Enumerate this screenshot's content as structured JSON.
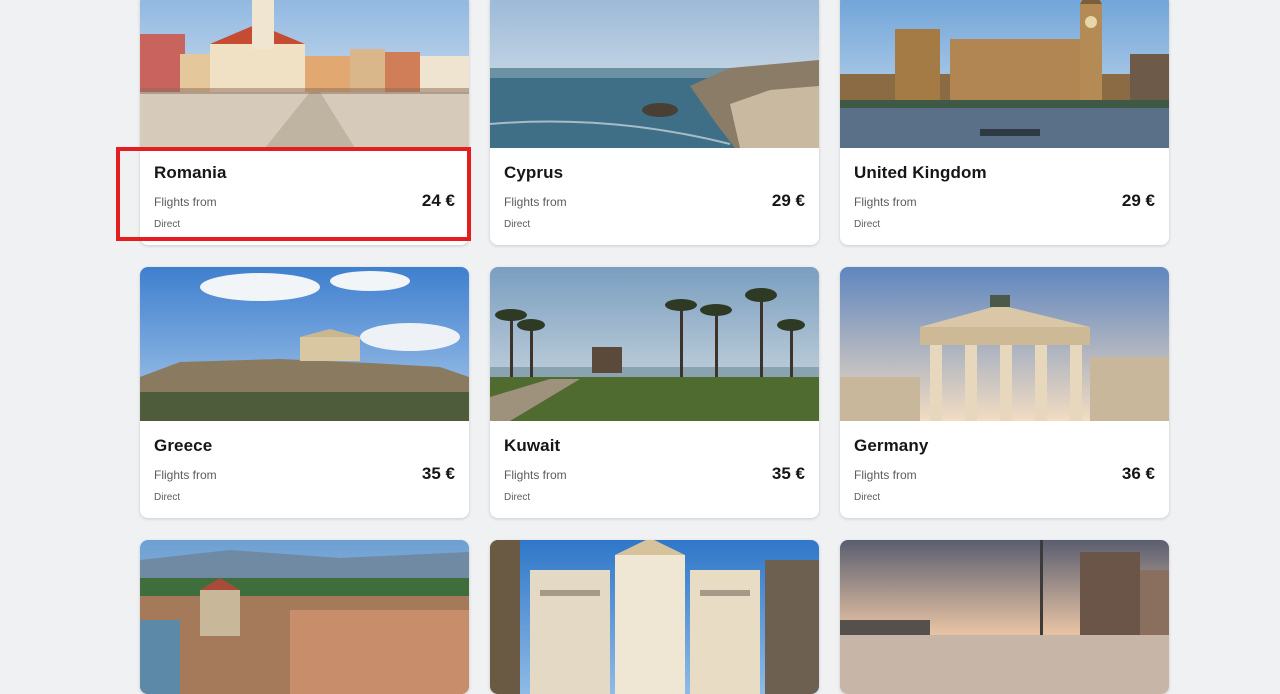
{
  "accent_color": "#e41e1e",
  "destinations": [
    {
      "name": "Romania",
      "flights_from_label": "Flights from",
      "price": "24 €",
      "stops": "Direct",
      "image": "brasov-council-square-photo"
    },
    {
      "name": "Cyprus",
      "flights_from_label": "Flights from",
      "price": "29 €",
      "stops": "Direct",
      "image": "coastal-sea-rock-photo"
    },
    {
      "name": "United Kingdom",
      "flights_from_label": "Flights from",
      "price": "29 €",
      "stops": "Direct",
      "image": "westminster-big-ben-photo"
    },
    {
      "name": "Greece",
      "flights_from_label": "Flights from",
      "price": "35 €",
      "stops": "Direct",
      "image": "acropolis-photo"
    },
    {
      "name": "Kuwait",
      "flights_from_label": "Flights from",
      "price": "35 €",
      "stops": "Direct",
      "image": "palm-park-photo"
    },
    {
      "name": "Germany",
      "flights_from_label": "Flights from",
      "price": "36 €",
      "stops": "Direct",
      "image": "brandenburg-gate-photo"
    },
    {
      "image": "budapest-parliament-photo"
    },
    {
      "image": "brussels-grand-place-photo"
    },
    {
      "image": "harbour-sunset-photo"
    }
  ]
}
